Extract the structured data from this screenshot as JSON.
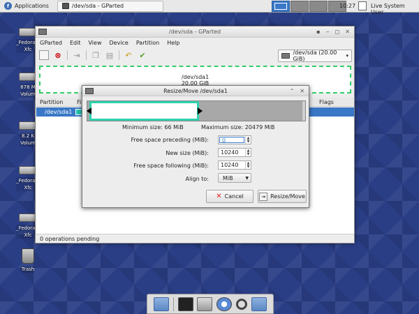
{
  "panel": {
    "apps_label": "Applications",
    "task_label": "/dev/sda - GParted",
    "clock": "10:27",
    "user_label": "Live System User"
  },
  "desktop": {
    "icons": [
      {
        "label": "_Fedora-L\nXfc"
      },
      {
        "label": "878 M\nVolum"
      },
      {
        "label": "8.2 K\nVolum"
      },
      {
        "label": "_Fedora-L\nXfc"
      },
      {
        "label": "_Fedora-L\nXfc"
      },
      {
        "label": "Trash"
      }
    ]
  },
  "gparted": {
    "title": "/dev/sda - GParted",
    "menu": [
      "GParted",
      "Edit",
      "View",
      "Device",
      "Partition",
      "Help"
    ],
    "device_selector": "/dev/sda  (20.00 GiB)",
    "graph_name": "/dev/sda1",
    "graph_size": "20.00 GiB",
    "columns": {
      "partition": "Partition",
      "fi": "Fi",
      "flags": "Flags"
    },
    "row": {
      "partition": "/dev/sda1"
    },
    "status": "0 operations pending"
  },
  "dialog": {
    "title": "Resize/Move /dev/sda1",
    "min_size": "Minimum size: 66 MiB",
    "max_size": "Maximum size: 20479 MiB",
    "fields": {
      "preceding_label": "Free space preceding (MiB):",
      "preceding_value": "0",
      "newsize_label": "New size (MiB):",
      "newsize_value": "10240",
      "following_label": "Free space following (MiB):",
      "following_value": "10240",
      "align_label": "Align to:",
      "align_value": "MiB"
    },
    "cancel_label": "Cancel",
    "resize_label": "Resize/Move",
    "used_fraction": 0.5
  },
  "colors": {
    "partition_accent": "#2fd1ae",
    "selection": "#3a78c7",
    "graph_border": "#33cc66"
  }
}
